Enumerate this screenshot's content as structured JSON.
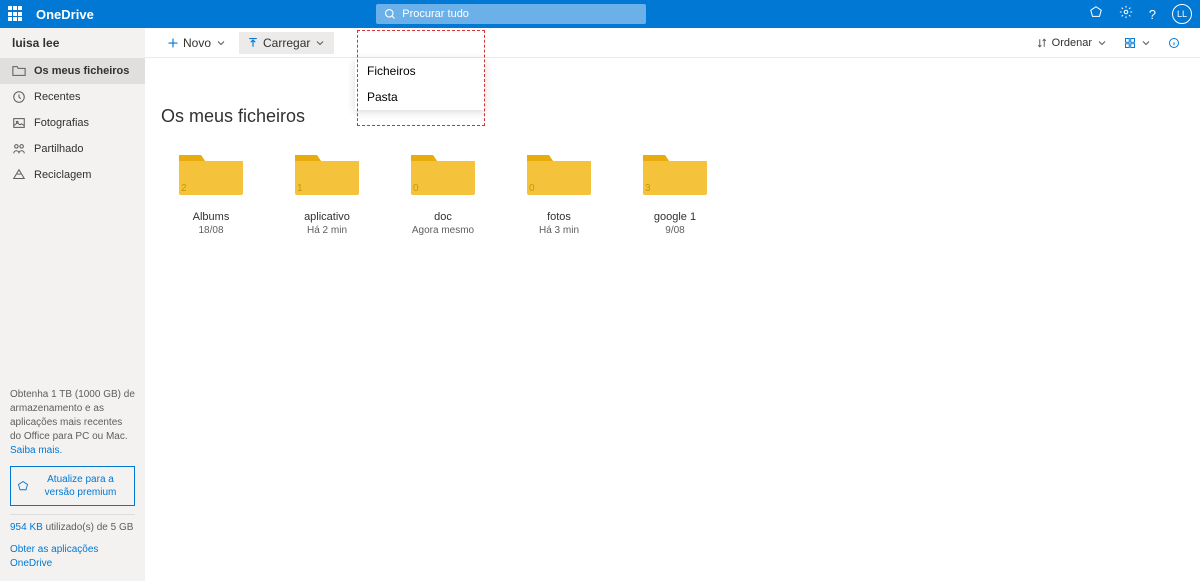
{
  "header": {
    "brand": "OneDrive",
    "search_placeholder": "Procurar tudo",
    "avatar_initials": "LL"
  },
  "sidebar": {
    "user": "luisa lee",
    "items": [
      {
        "icon": "folder",
        "label": "Os meus ficheiros"
      },
      {
        "icon": "clock",
        "label": "Recentes"
      },
      {
        "icon": "photo",
        "label": "Fotografias"
      },
      {
        "icon": "share",
        "label": "Partilhado"
      },
      {
        "icon": "trash",
        "label": "Reciclagem"
      }
    ],
    "promo_text": "Obtenha 1 TB (1000 GB) de armazenamento e as aplicações mais recentes do Office para PC ou Mac.",
    "learn_more": "Saiba mais.",
    "premium_button": "Atualize para a versão premium",
    "usage_link": "954 KB",
    "usage_rest": " utilizado(s) de 5 GB",
    "get_apps": "Obter as aplicações OneDrive"
  },
  "toolbar": {
    "new_label": "Novo",
    "upload_label": "Carregar",
    "sort_label": "Ordenar"
  },
  "dropdown": {
    "items": [
      "Ficheiros",
      "Pasta"
    ]
  },
  "page": {
    "title": "Os meus ficheiros"
  },
  "folders": [
    {
      "name": "Albums",
      "date": "18/08",
      "count": "2"
    },
    {
      "name": "aplicativo",
      "date": "Há 2 min",
      "count": "1"
    },
    {
      "name": "doc",
      "date": "Agora mesmo",
      "count": "0"
    },
    {
      "name": "fotos",
      "date": "Há 3 min",
      "count": "0"
    },
    {
      "name": "google 1",
      "date": "9/08",
      "count": "3"
    }
  ]
}
